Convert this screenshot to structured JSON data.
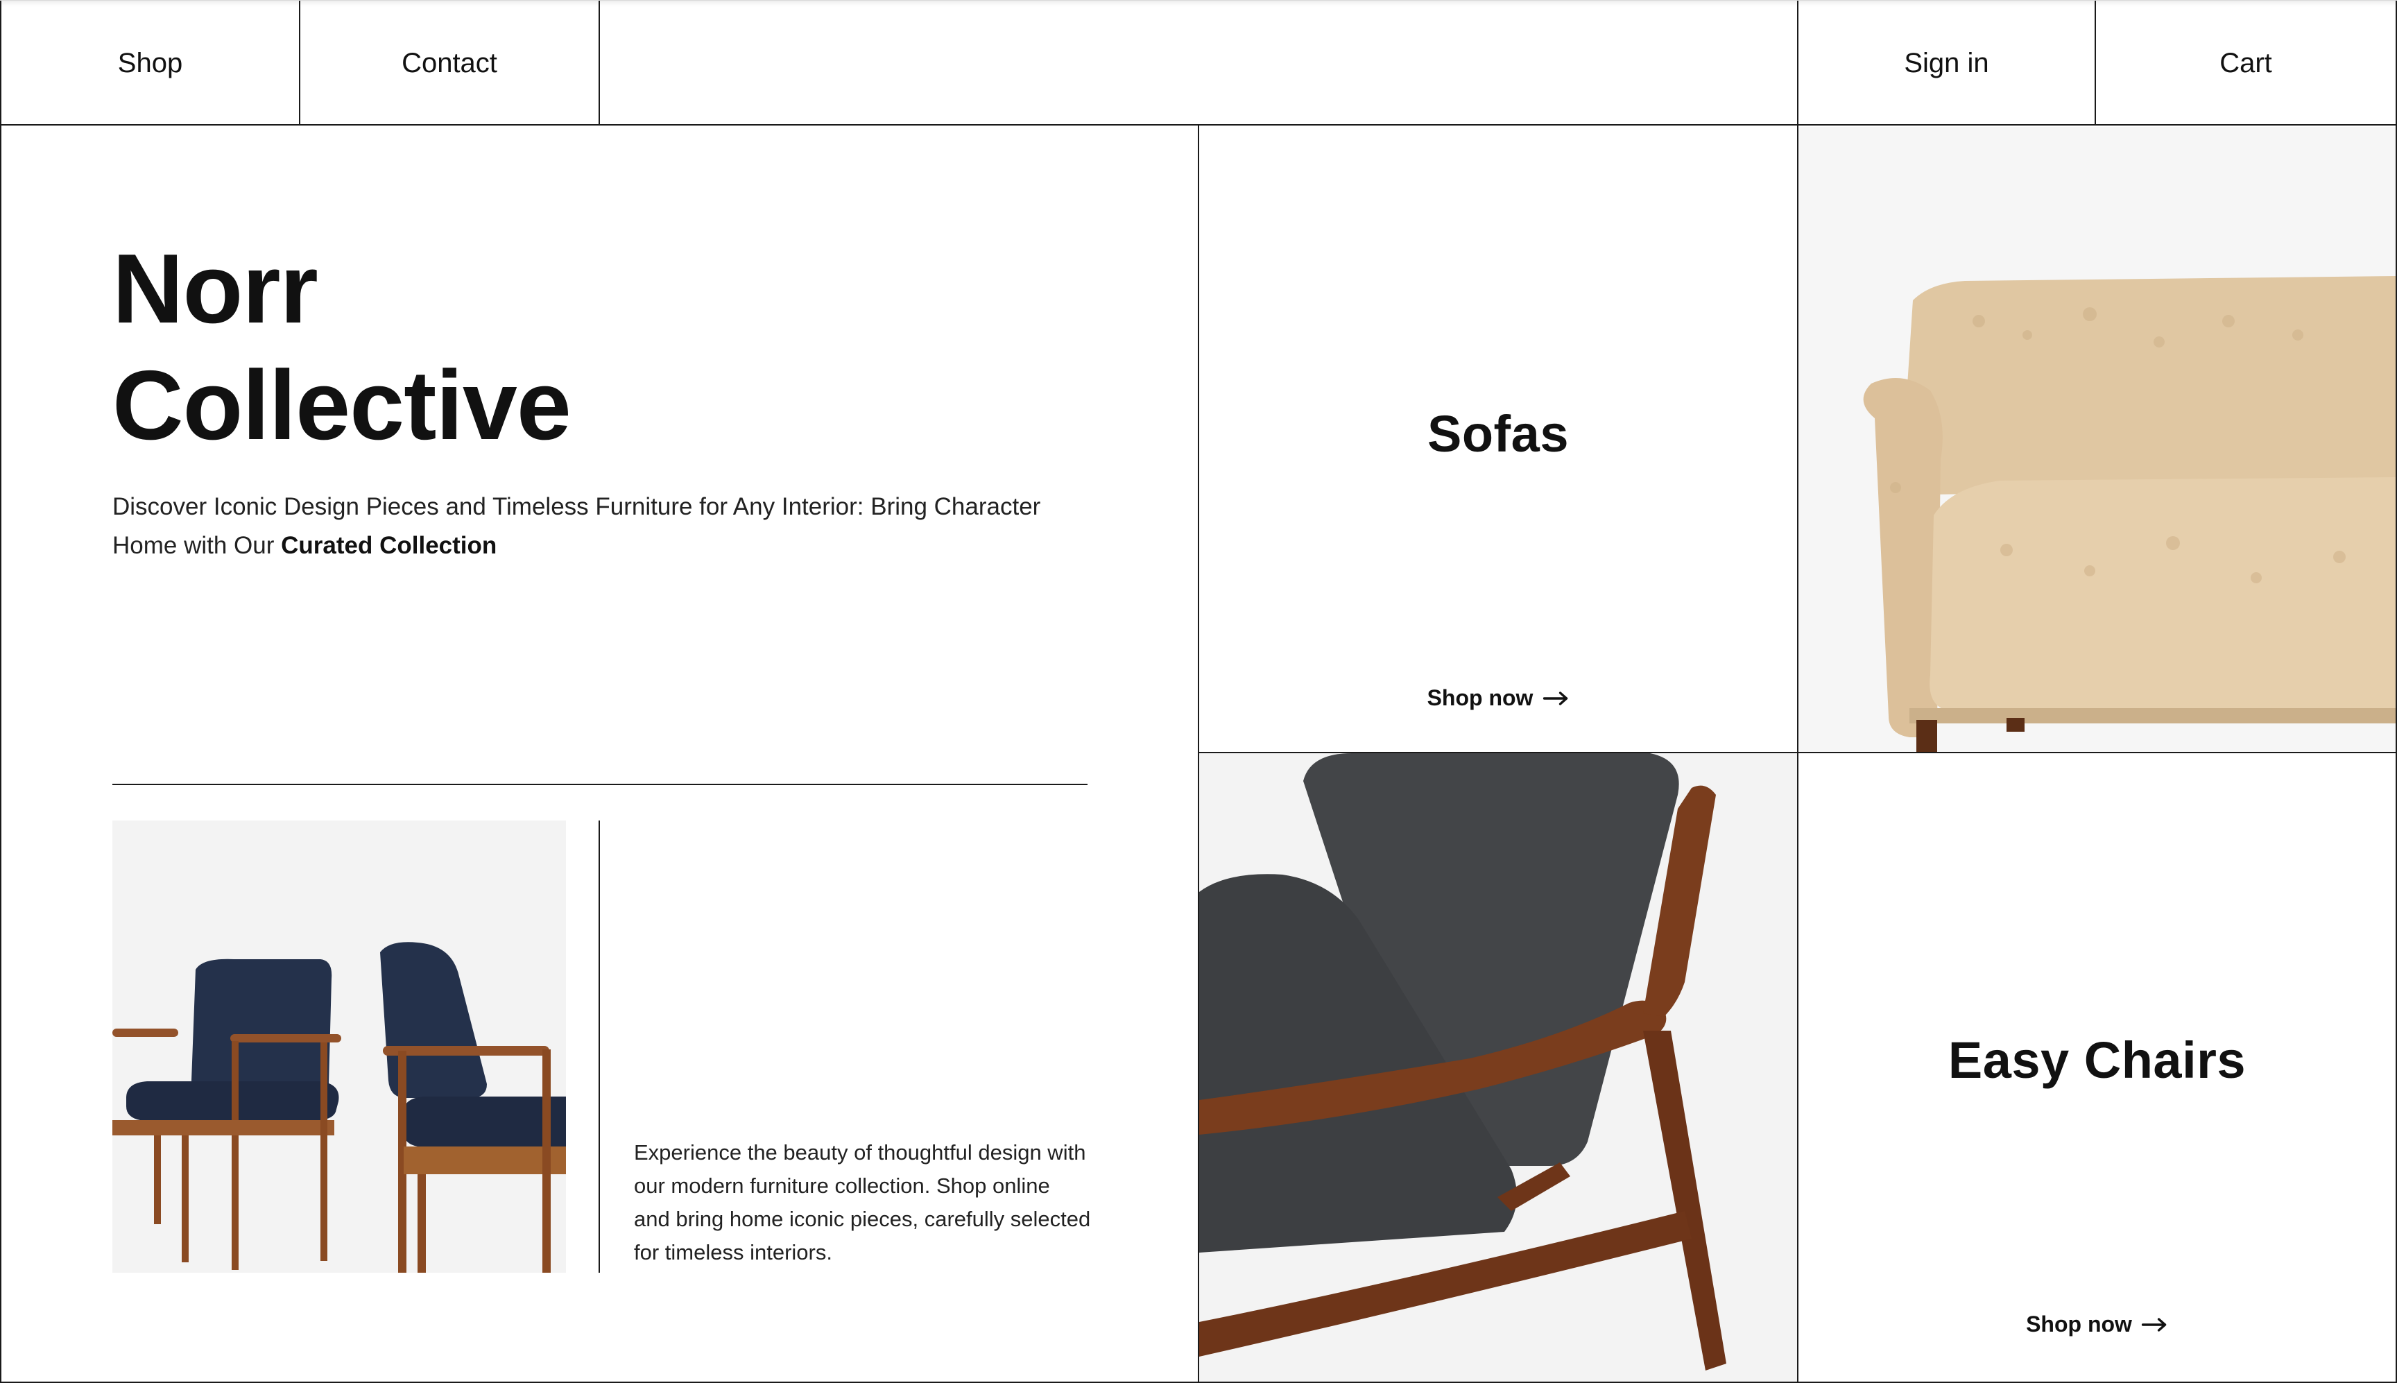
{
  "nav": {
    "shop": "Shop",
    "contact": "Contact",
    "sign_in": "Sign in",
    "cart": "Cart"
  },
  "hero": {
    "title_line1": "Norr",
    "title_line2": "Collective",
    "description_lead": "Discover Iconic Design Pieces and Timeless Furniture for Any Interior: Bring Character Home with Our ",
    "description_emphasis": "Curated Collection",
    "body_text": "Experience the beauty of thoughtful design with our modern furniture collection. Shop online and bring home iconic pieces, carefully selected for timeless interiors."
  },
  "tiles": {
    "sofas": {
      "title": "Sofas",
      "link": "Shop now"
    },
    "easy_chairs": {
      "title": "Easy Chairs",
      "link": "Shop now"
    }
  },
  "colors": {
    "border": "#1a1a1a",
    "text": "#111111",
    "wood": "#8a4a22",
    "upholstery_navy": "#23304a",
    "felt_gray": "#434548",
    "shearling": "#e0c7a2"
  },
  "icons": {
    "link_arrow": "arrow-right-icon"
  }
}
